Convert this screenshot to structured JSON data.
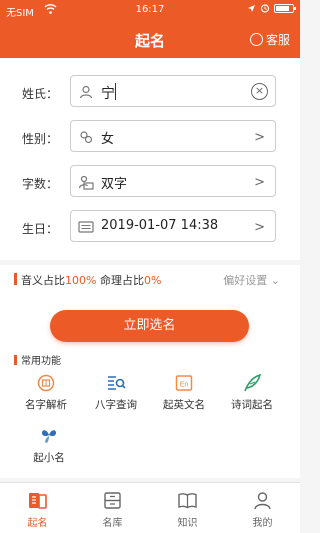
{
  "status_bar": {
    "carrier": "无SIM",
    "time": "16:17",
    "battery_level": 0.8
  },
  "nav": {
    "title": "起名",
    "service_label": "客服"
  },
  "form": {
    "surname": {
      "label": "姓氏：",
      "value": "宁"
    },
    "gender": {
      "label": "性别：",
      "value": "女"
    },
    "char_count": {
      "label": "字数：",
      "value": "双字"
    },
    "birth": {
      "label": "生日：",
      "value": "2019-01-07 14:38"
    }
  },
  "ratio": {
    "sound_label": "音义占比",
    "sound_pct": "100%",
    "fate_label": "命理占比",
    "fate_pct": "0%",
    "preferences_label": "偏好设置",
    "preferences_icon": "chevron-down-icon"
  },
  "cta_label": "立即选名",
  "functions": {
    "title": "常用功能",
    "items": [
      {
        "label": "名字解析",
        "icon": "name-analysis-icon"
      },
      {
        "label": "八字查询",
        "icon": "bazi-search-icon"
      },
      {
        "label": "起英文名",
        "icon": "english-name-icon"
      },
      {
        "label": "诗词起名",
        "icon": "poetry-feather-icon"
      },
      {
        "label": "起小名",
        "icon": "nickname-icon"
      }
    ]
  },
  "tabs": [
    {
      "label": "起名",
      "active": true,
      "icon": "naming-icon"
    },
    {
      "label": "名库",
      "active": false,
      "icon": "name-library-icon"
    },
    {
      "label": "知识",
      "active": false,
      "icon": "book-icon"
    },
    {
      "label": "我的",
      "active": false,
      "icon": "profile-icon"
    }
  ],
  "colors": {
    "brand": "#ec5a28",
    "function_icon_orange": "#f08a4b",
    "function_icon_blue": "#2e6fb8",
    "function_icon_green": "#2f9e6b"
  }
}
